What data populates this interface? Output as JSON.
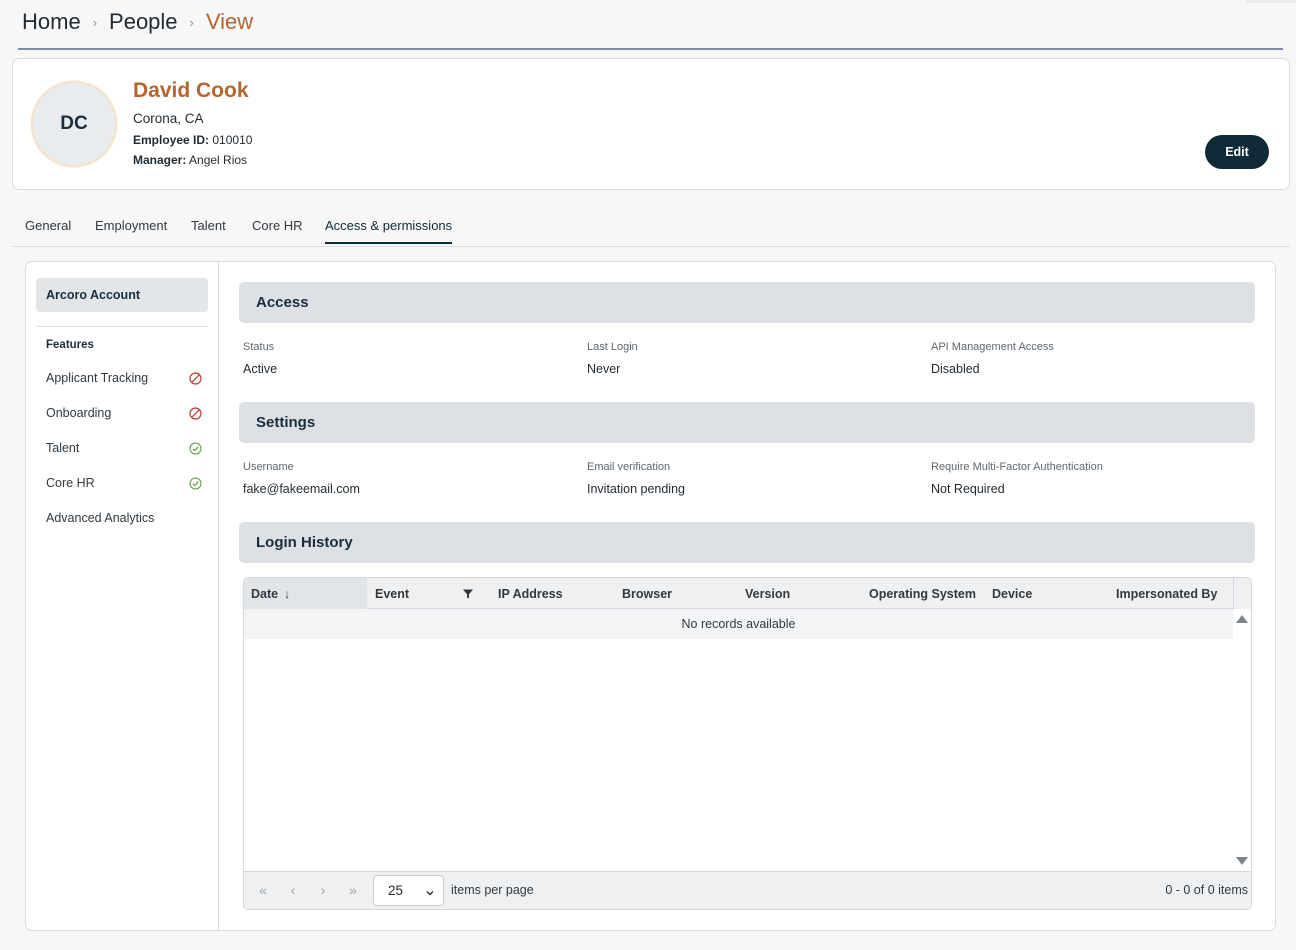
{
  "breadcrumb": {
    "items": [
      "Home",
      "People",
      "View"
    ],
    "separator": "›"
  },
  "profile": {
    "initials": "DC",
    "name": "David Cook",
    "location": "Corona, CA",
    "employee_id_label": "Employee ID:",
    "employee_id": "010010",
    "manager_label": "Manager:",
    "manager": "Angel Rios",
    "edit_label": "Edit"
  },
  "tabs": [
    {
      "label": "General"
    },
    {
      "label": "Employment"
    },
    {
      "label": "Talent"
    },
    {
      "label": "Core HR"
    },
    {
      "label": "Access & permissions",
      "active": true
    }
  ],
  "sidebar": {
    "account_label": "Arcoro Account",
    "features_heading": "Features",
    "features": [
      {
        "label": "Applicant Tracking",
        "status": "disabled",
        "icon": "disabled-icon"
      },
      {
        "label": "Onboarding",
        "status": "disabled",
        "icon": "disabled-icon"
      },
      {
        "label": "Talent",
        "status": "enabled",
        "icon": "check-icon"
      },
      {
        "label": "Core HR",
        "status": "enabled",
        "icon": "check-icon"
      },
      {
        "label": "Advanced Analytics",
        "status": "none",
        "icon": ""
      }
    ]
  },
  "access": {
    "title": "Access",
    "fields": [
      {
        "label": "Status",
        "value": "Active"
      },
      {
        "label": "Last Login",
        "value": "Never"
      },
      {
        "label": "API Management Access",
        "value": "Disabled"
      }
    ]
  },
  "settings": {
    "title": "Settings",
    "fields": [
      {
        "label": "Username",
        "value": "fake@fakeemail.com"
      },
      {
        "label": "Email verification",
        "value": "Invitation pending"
      },
      {
        "label": "Require Multi-Factor Authentication",
        "value": "Not Required"
      }
    ]
  },
  "login_history": {
    "title": "Login History",
    "columns": [
      "Date",
      "Event",
      "IP Address",
      "Browser",
      "Version",
      "Operating System",
      "Device",
      "Impersonated By"
    ],
    "sort_indicator": "↓",
    "empty_text": "No records available",
    "pager": {
      "page_size": "25",
      "items_per_page_label": "items per page",
      "range_text": "0 - 0 of 0 items"
    }
  },
  "colors": {
    "accent": "#b5652e",
    "primary_dark": "#0f2a37",
    "disabled_red": "#c0392b",
    "enabled_green": "#5b9a3c"
  }
}
